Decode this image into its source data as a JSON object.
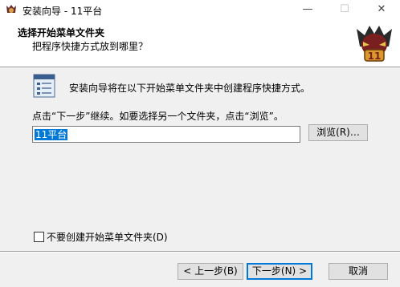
{
  "window": {
    "title": "安装向导 - 11平台",
    "minimize": "—",
    "maximize": "☐",
    "close": "✕"
  },
  "header": {
    "title": "选择开始菜单文件夹",
    "subtitle": "把程序快捷方式放到哪里？",
    "logo_number": "11"
  },
  "content": {
    "intro": "安装向导将在以下开始菜单文件夹中创建程序快捷方式。",
    "hint": "点击“下一步”继续。如要选择另一个文件夹，点击“浏览”。",
    "folder_value": "11平台",
    "browse_label": "浏览(R)…",
    "no_folder_label": "不要创建开始菜单文件夹(D)",
    "no_folder_checked": false
  },
  "footer": {
    "back_label": "< 上一步(B)",
    "next_label": "下一步(N) >",
    "cancel_label": "取消"
  }
}
